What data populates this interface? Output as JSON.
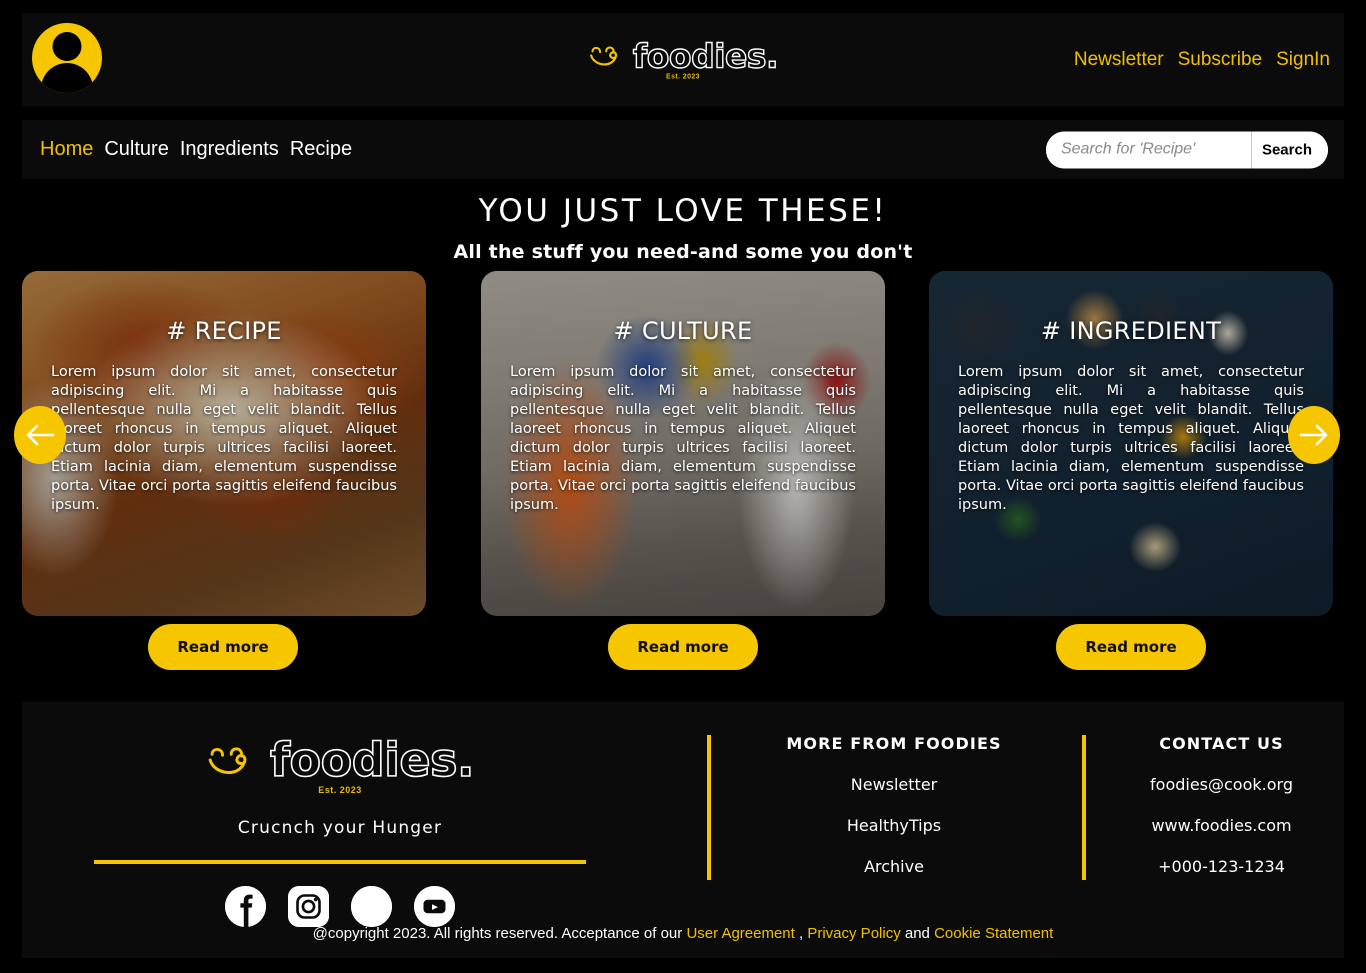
{
  "header": {
    "avatar_icon": "user-avatar-icon",
    "brand": {
      "word": "foodies.",
      "est": "Est. 2023",
      "icon": "smiley-swoosh-icon"
    },
    "links": [
      {
        "label": "Newsletter"
      },
      {
        "label": "Subscribe"
      },
      {
        "label": "SignIn"
      }
    ]
  },
  "nav": {
    "items": [
      {
        "label": "Home",
        "active": true
      },
      {
        "label": "Culture",
        "active": false
      },
      {
        "label": "Ingredients",
        "active": false
      },
      {
        "label": "Recipe",
        "active": false
      }
    ],
    "search": {
      "placeholder": "Search for 'Recipe'",
      "value": "",
      "button_label": "Search"
    }
  },
  "section": {
    "title": "YOU JUST LOVE THESE!",
    "subtitle": "All the stuff you need-and some you don't"
  },
  "carousel": {
    "prev_icon": "arrow-left-icon",
    "next_icon": "arrow-right-icon",
    "body_text": "Lorem ipsum dolor sit amet, consectetur adipiscing elit. Mi a habitasse quis pellentesque nulla eget velit blandit. Tellus laoreet rhoncus in tempus aliquet. Aliquet dictum dolor turpis ultrices facilisi laoreet. Etiam lacinia diam, elementum suspendisse porta. Vitae orci porta sagittis eleifend faucibus ipsum.",
    "cards": [
      {
        "heading": "# RECIPE",
        "text": "Lorem ipsum dolor sit amet, consectetur adipiscing elit. Mi a habitasse quis pellentesque nulla eget velit blandit. Tellus laoreet rhoncus in tempus aliquet. Aliquet dictum dolor turpis ultrices facilisi laoreet. Etiam lacinia diam, elementum suspendisse porta. Vitae orci porta sagittis eleifend faucibus ipsum.",
        "image": "baked-lasagna-in-glass-dish",
        "button_label": "Read more"
      },
      {
        "heading": "# CULTURE",
        "text": "Lorem ipsum dolor sit amet, consectetur adipiscing elit. Mi a habitasse quis pellentesque nulla eget velit blandit. Tellus laoreet rhoncus in tempus aliquet. Aliquet dictum dolor turpis ultrices facilisi laoreet. Etiam lacinia diam, elementum suspendisse porta. Vitae orci porta sagittis eleifend faucibus ipsum.",
        "image": "international-food-festival-market",
        "button_label": "Read more"
      },
      {
        "heading": "# INGREDIENT",
        "text": "Lorem ipsum dolor sit amet, consectetur adipiscing elit. Mi a habitasse quis pellentesque nulla eget velit blandit. Tellus laoreet rhoncus in tempus aliquet. Aliquet dictum dolor turpis ultrices facilisi laoreet. Etiam lacinia diam, elementum suspendisse porta. Vitae orci porta sagittis eleifend faucibus ipsum.",
        "image": "spices-and-ingredients-flatlay",
        "button_label": "Read more"
      }
    ]
  },
  "footer": {
    "brand": {
      "word": "foodies.",
      "est": "Est. 2023"
    },
    "tagline": "Crucnch your Hunger",
    "socials": [
      {
        "name": "facebook-icon"
      },
      {
        "name": "instagram-icon"
      },
      {
        "name": "linkedin-icon"
      },
      {
        "name": "youtube-icon"
      }
    ],
    "more": {
      "title": "MORE FROM FOODIES",
      "items": [
        {
          "label": "Newsletter"
        },
        {
          "label": "HealthyTips"
        },
        {
          "label": "Archive"
        }
      ]
    },
    "contact": {
      "title": "CONTACT US",
      "items": [
        {
          "label": "foodies@cook.org"
        },
        {
          "label": "www.foodies.com"
        },
        {
          "label": "+000-123-1234"
        }
      ]
    },
    "copyright": {
      "prefix": "@copyright 2023. All rights reserved. Acceptance of our ",
      "link1": "User Agreement ",
      "sep1": ", ",
      "link2": "Privacy Policy",
      "sep2": " and ",
      "link3": "Cookie Statement"
    }
  },
  "colors": {
    "accent": "#f6c700",
    "accent_text": "#f0c000",
    "background": "#000000",
    "panel": "#0b0b0b",
    "text": "#ffffff"
  }
}
